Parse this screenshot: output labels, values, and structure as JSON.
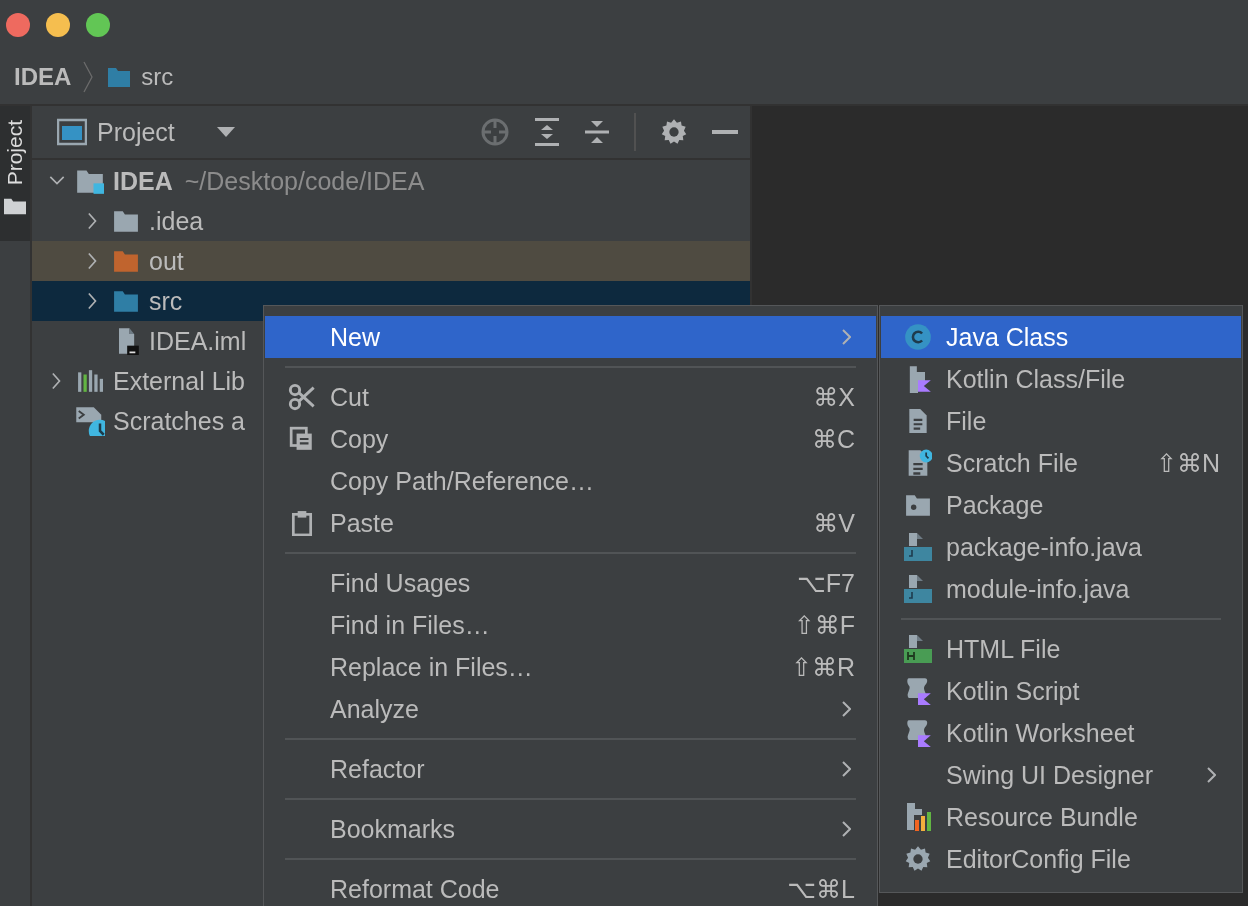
{
  "window": {
    "traffic_lights": [
      {
        "color": "#ee6a5f"
      },
      {
        "color": "#f5be4f"
      },
      {
        "color": "#62c655"
      }
    ]
  },
  "breadcrumb": [
    {
      "label": "IDEA",
      "kind": "project"
    },
    {
      "label": "src",
      "kind": "folder"
    }
  ],
  "tool_strip": {
    "tabs": [
      {
        "label": "Project",
        "selected": true
      }
    ]
  },
  "project_panel": {
    "title": "Project",
    "tree": [
      {
        "label": "IDEA",
        "path": "~/Desktop/code/IDEA",
        "kind": "module",
        "expanded": true,
        "selected": false,
        "children": [
          {
            "label": ".idea",
            "kind": "folder",
            "expanded": false,
            "selected": false
          },
          {
            "label": "out",
            "kind": "excluded",
            "expanded": false,
            "selected": false
          },
          {
            "label": "src",
            "kind": "source",
            "expanded": false,
            "selected": true
          },
          {
            "label": "IDEA.iml",
            "kind": "file",
            "selected": false
          }
        ]
      },
      {
        "label": "External Lib",
        "kind": "libraries",
        "expanded": false,
        "selected": false
      },
      {
        "label": "Scratches a",
        "kind": "scratches",
        "selected": false
      }
    ]
  },
  "context_menu": {
    "items": [
      {
        "kind": "submenu",
        "label": "New",
        "selected": true
      },
      {
        "kind": "separator"
      },
      {
        "kind": "item",
        "label": "Cut",
        "shortcut": "⌘X",
        "selected": false
      },
      {
        "kind": "item",
        "label": "Copy",
        "shortcut": "⌘C",
        "selected": false
      },
      {
        "kind": "item",
        "label": "Copy Path/Reference…",
        "selected": false
      },
      {
        "kind": "item",
        "label": "Paste",
        "shortcut": "⌘V",
        "selected": false
      },
      {
        "kind": "separator"
      },
      {
        "kind": "item",
        "label": "Find Usages",
        "shortcut": "⌥F7",
        "selected": false
      },
      {
        "kind": "item",
        "label": "Find in Files…",
        "shortcut": "⇧⌘F",
        "selected": false
      },
      {
        "kind": "item",
        "label": "Replace in Files…",
        "shortcut": "⇧⌘R",
        "selected": false
      },
      {
        "kind": "submenu",
        "label": "Analyze",
        "selected": false
      },
      {
        "kind": "separator"
      },
      {
        "kind": "submenu",
        "label": "Refactor",
        "selected": false
      },
      {
        "kind": "separator"
      },
      {
        "kind": "submenu",
        "label": "Bookmarks",
        "selected": false
      },
      {
        "kind": "separator"
      },
      {
        "kind": "item",
        "label": "Reformat Code",
        "shortcut": "⌥⌘L",
        "selected": false
      }
    ]
  },
  "new_submenu": {
    "items": [
      {
        "kind": "item",
        "label": "Java Class",
        "selected": true
      },
      {
        "kind": "item",
        "label": "Kotlin Class/File",
        "selected": false
      },
      {
        "kind": "item",
        "label": "File",
        "selected": false
      },
      {
        "kind": "item",
        "label": "Scratch File",
        "shortcut": "⇧⌘N",
        "selected": false
      },
      {
        "kind": "item",
        "label": "Package",
        "selected": false
      },
      {
        "kind": "item",
        "label": "package-info.java",
        "selected": false
      },
      {
        "kind": "item",
        "label": "module-info.java",
        "selected": false
      },
      {
        "kind": "separator"
      },
      {
        "kind": "item",
        "label": "HTML File",
        "selected": false
      },
      {
        "kind": "item",
        "label": "Kotlin Script",
        "selected": false
      },
      {
        "kind": "item",
        "label": "Kotlin Worksheet",
        "selected": false
      },
      {
        "kind": "submenu",
        "label": "Swing UI Designer",
        "selected": false
      },
      {
        "kind": "item",
        "label": "Resource Bundle",
        "selected": false
      },
      {
        "kind": "item",
        "label": "EditorConfig File",
        "selected": false
      }
    ]
  }
}
